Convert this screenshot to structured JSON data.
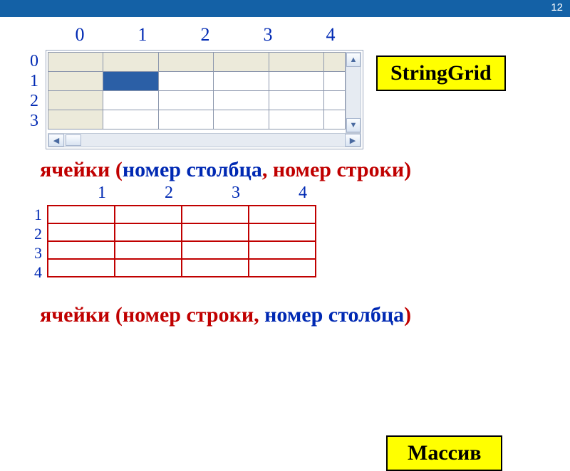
{
  "slide_number": "12",
  "stringgrid": {
    "col_indices": [
      "0",
      "1",
      "2",
      "3",
      "4"
    ],
    "row_indices": [
      "0",
      "1",
      "2",
      "3"
    ],
    "selected_cell": {
      "row": 1,
      "col": 1
    },
    "label": "StringGrid"
  },
  "caption1": {
    "part1": "ячейки (",
    "part2": "номер столбца",
    "part3": ", ",
    "part4": "номер строки",
    "part5": ")"
  },
  "array": {
    "col_indices": [
      "1",
      "2",
      "3",
      "4"
    ],
    "row_indices": [
      "1",
      "2",
      "3",
      "4"
    ],
    "label": "Массив"
  },
  "caption2": {
    "part1": "ячейки (",
    "part2": "номер строки",
    "part3": ", ",
    "part4": "номер столбца",
    "part5": ")"
  }
}
